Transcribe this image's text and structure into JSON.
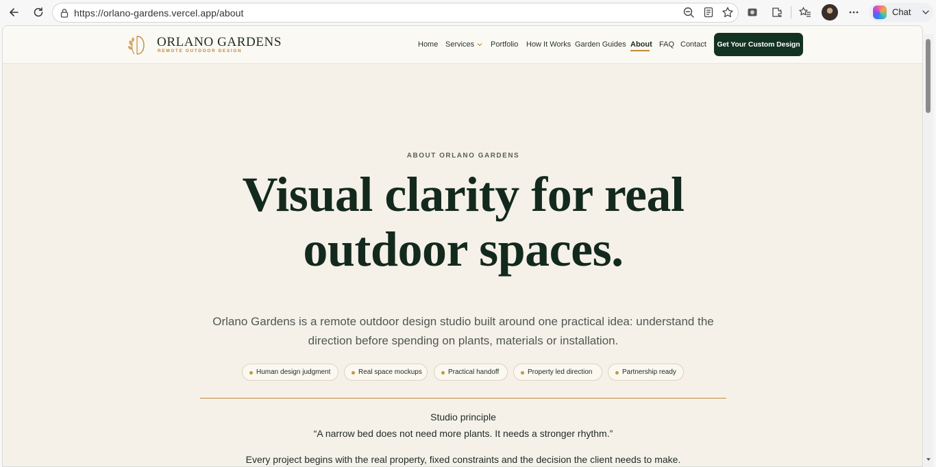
{
  "browser": {
    "url": "https://orlano-gardens.vercel.app/about",
    "chat_label": "Chat"
  },
  "site": {
    "brand_name": "ORLANO GARDENS",
    "brand_tagline": "REMOTE OUTDOOR DESIGN",
    "nav": [
      "Home",
      "Services",
      "Portfolio",
      "How It Works",
      "Garden Guides",
      "About",
      "FAQ",
      "Contact"
    ],
    "active_nav": "About",
    "cta_label": "Get Your Custom Design",
    "accent_color": "#c4873a",
    "dark_green": "#123222"
  },
  "hero": {
    "eyebrow": "ABOUT ORLANO GARDENS",
    "title_line1": "Visual clarity for real",
    "title_line2": "outdoor spaces.",
    "lead_line1": "Orlano Gardens is a remote outdoor design studio built around one practical idea: understand the",
    "lead_line2": "direction before spending on plants, materials or installation.",
    "tags": [
      "Human design judgment",
      "Real space mockups",
      "Practical handoff",
      "Property led direction",
      "Partnership ready"
    ]
  },
  "principle": {
    "label": "Studio principle",
    "quote": "“A narrow bed does not need more plants. It needs a stronger rhythm.”",
    "body": "Every project begins with the real property, fixed constraints and the decision the client needs to make."
  }
}
